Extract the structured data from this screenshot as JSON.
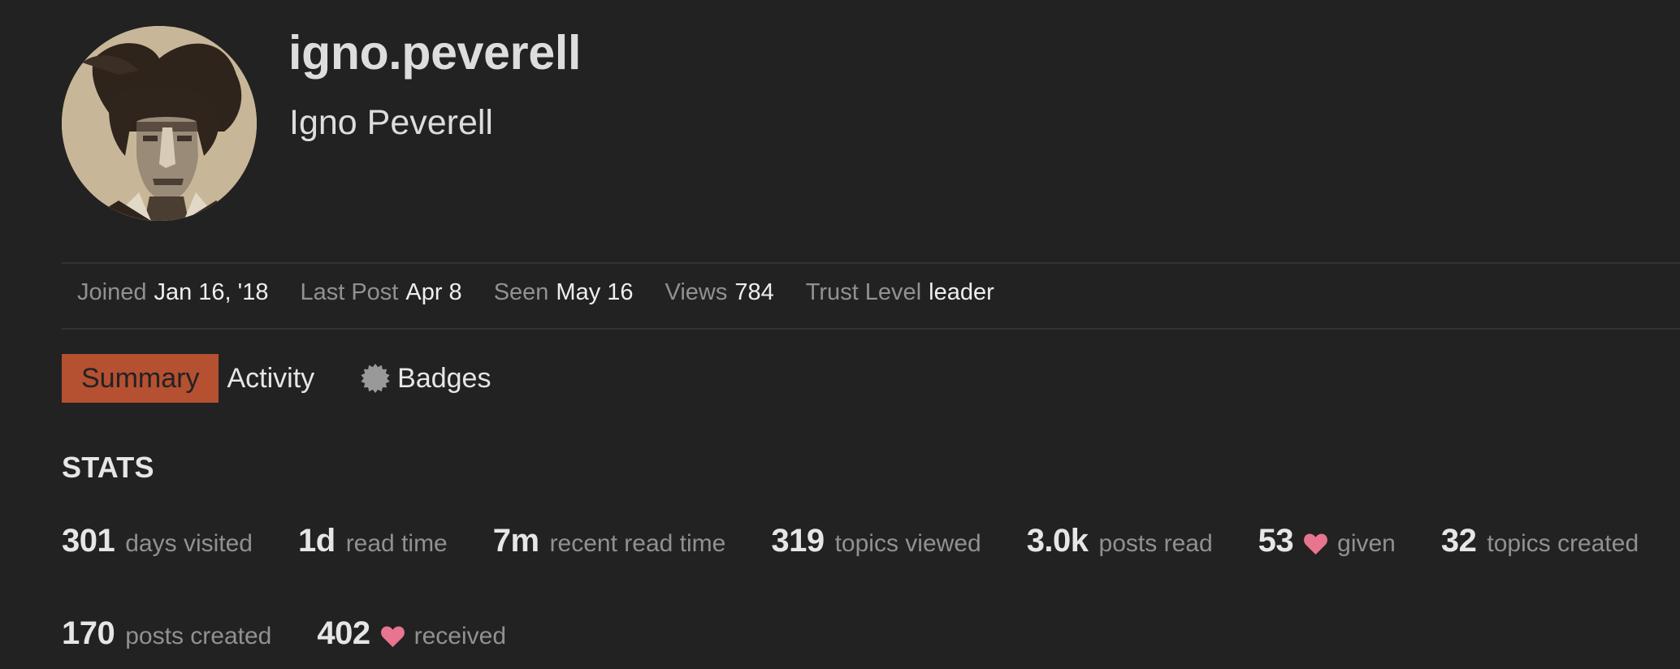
{
  "profile": {
    "username": "igno.peverell",
    "full_name": "Igno Peverell",
    "avatar_alt": "sketch portrait avatar"
  },
  "info_bar": [
    {
      "label": "Joined",
      "value": "Jan 16, '18"
    },
    {
      "label": "Last Post",
      "value": "Apr 8"
    },
    {
      "label": "Seen",
      "value": "May 16"
    },
    {
      "label": "Views",
      "value": "784"
    },
    {
      "label": "Trust Level",
      "value": "leader"
    }
  ],
  "tabs": [
    {
      "label": "Summary",
      "active": true,
      "icon": null
    },
    {
      "label": "Activity",
      "active": false,
      "icon": null
    },
    {
      "label": "Badges",
      "active": false,
      "icon": "badge-starburst-icon"
    }
  ],
  "stats": {
    "heading": "STATS",
    "items": [
      {
        "value": "301",
        "label": "days visited",
        "icon": null
      },
      {
        "value": "1d",
        "label": "read time",
        "icon": null
      },
      {
        "value": "7m",
        "label": "recent read time",
        "icon": null
      },
      {
        "value": "319",
        "label": "topics viewed",
        "icon": null
      },
      {
        "value": "3.0k",
        "label": "posts read",
        "icon": null
      },
      {
        "value": "53",
        "label": "given",
        "icon": "heart-icon"
      },
      {
        "value": "32",
        "label": "topics created",
        "icon": null
      },
      {
        "value": "170",
        "label": "posts created",
        "icon": null
      },
      {
        "value": "402",
        "label": "received",
        "icon": "heart-icon"
      }
    ]
  },
  "colors": {
    "background": "#222222",
    "accent_tab": "#b55031",
    "heart": "#e8758f",
    "label_gray": "#919191",
    "text_light": "#dddddd",
    "badge_icon": "#999999"
  }
}
